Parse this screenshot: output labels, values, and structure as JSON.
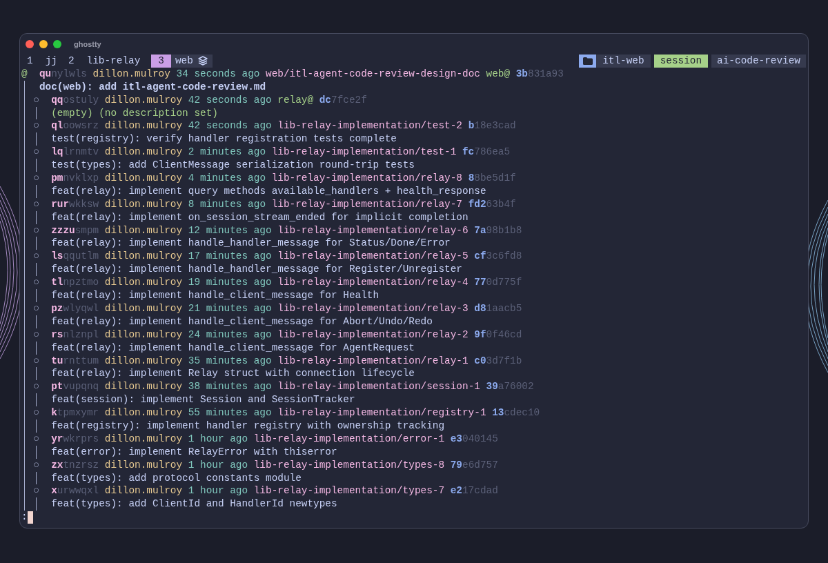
{
  "window": {
    "title": "ghostty"
  },
  "tabs": [
    {
      "index": "1",
      "label": "jj",
      "selected": false
    },
    {
      "index": "2",
      "label": "lib-relay",
      "selected": false
    },
    {
      "index": "3",
      "label": "web",
      "selected": true
    }
  ],
  "session": {
    "directory": "itl-web",
    "name": "session",
    "project": "ai-code-review"
  },
  "log": [
    {
      "kind": "working_copy",
      "marker": "@",
      "change_prefix": "qu",
      "change_rest": "nylwls",
      "author": "dillon.mulroy",
      "time": "34 seconds ago",
      "bookmarks": [
        {
          "name": "web/itl-agent-code-review-design-doc",
          "kind": "local"
        },
        {
          "name": "web@",
          "kind": "remote"
        }
      ],
      "commit_prefix": "3b",
      "commit_rest": "831a93",
      "description": "doc(web): add itl-agent-code-review.md",
      "description_empty": false
    },
    {
      "kind": "commit",
      "marker": "○",
      "change_prefix": "qq",
      "change_rest": "ostuly",
      "author": "dillon.mulroy",
      "time": "42 seconds ago",
      "bookmarks": [
        {
          "name": "relay@",
          "kind": "remote"
        }
      ],
      "commit_prefix": "dc",
      "commit_rest": "7fce2f",
      "description": "(empty) (no description set)",
      "description_empty": true
    },
    {
      "kind": "commit",
      "marker": "○",
      "change_prefix": "ql",
      "change_rest": "oowsrz",
      "author": "dillon.mulroy",
      "time": "42 seconds ago",
      "bookmarks": [
        {
          "name": "lib-relay-implementation/test-2",
          "kind": "local"
        }
      ],
      "commit_prefix": "b",
      "commit_rest": "18e3cad",
      "description": "test(registry): verify handler registration tests complete",
      "description_empty": false
    },
    {
      "kind": "commit",
      "marker": "○",
      "change_prefix": "lq",
      "change_rest": "lrnmtv",
      "author": "dillon.mulroy",
      "time": "2 minutes ago",
      "bookmarks": [
        {
          "name": "lib-relay-implementation/test-1",
          "kind": "local"
        }
      ],
      "commit_prefix": "fc",
      "commit_rest": "786ea5",
      "description": "test(types): add ClientMessage serialization round-trip tests",
      "description_empty": false
    },
    {
      "kind": "commit",
      "marker": "○",
      "change_prefix": "pm",
      "change_rest": "nvklxp",
      "author": "dillon.mulroy",
      "time": "4 minutes ago",
      "bookmarks": [
        {
          "name": "lib-relay-implementation/relay-8",
          "kind": "local"
        }
      ],
      "commit_prefix": "8",
      "commit_rest": "8be5d1f",
      "description": "feat(relay): implement query methods available_handlers + health_response",
      "description_empty": false
    },
    {
      "kind": "commit",
      "marker": "○",
      "change_prefix": "rur",
      "change_rest": "wkksw",
      "author": "dillon.mulroy",
      "time": "8 minutes ago",
      "bookmarks": [
        {
          "name": "lib-relay-implementation/relay-7",
          "kind": "local"
        }
      ],
      "commit_prefix": "fd2",
      "commit_rest": "63b4f",
      "description": "feat(relay): implement on_session_stream_ended for implicit completion",
      "description_empty": false
    },
    {
      "kind": "commit",
      "marker": "○",
      "change_prefix": "zzzu",
      "change_rest": "smpm",
      "author": "dillon.mulroy",
      "time": "12 minutes ago",
      "bookmarks": [
        {
          "name": "lib-relay-implementation/relay-6",
          "kind": "local"
        }
      ],
      "commit_prefix": "7a",
      "commit_rest": "98b1b8",
      "description": "feat(relay): implement handle_handler_message for Status/Done/Error",
      "description_empty": false
    },
    {
      "kind": "commit",
      "marker": "○",
      "change_prefix": "ls",
      "change_rest": "qqutlm",
      "author": "dillon.mulroy",
      "time": "17 minutes ago",
      "bookmarks": [
        {
          "name": "lib-relay-implementation/relay-5",
          "kind": "local"
        }
      ],
      "commit_prefix": "cf",
      "commit_rest": "3c6fd8",
      "description": "feat(relay): implement handle_handler_message for Register/Unregister",
      "description_empty": false
    },
    {
      "kind": "commit",
      "marker": "○",
      "change_prefix": "tl",
      "change_rest": "npztmo",
      "author": "dillon.mulroy",
      "time": "19 minutes ago",
      "bookmarks": [
        {
          "name": "lib-relay-implementation/relay-4",
          "kind": "local"
        }
      ],
      "commit_prefix": "77",
      "commit_rest": "0d775f",
      "description": "feat(relay): implement handle_client_message for Health",
      "description_empty": false
    },
    {
      "kind": "commit",
      "marker": "○",
      "change_prefix": "pz",
      "change_rest": "wlyqwl",
      "author": "dillon.mulroy",
      "time": "21 minutes ago",
      "bookmarks": [
        {
          "name": "lib-relay-implementation/relay-3",
          "kind": "local"
        }
      ],
      "commit_prefix": "d8",
      "commit_rest": "1aacb5",
      "description": "feat(relay): implement handle_client_message for Abort/Undo/Redo",
      "description_empty": false
    },
    {
      "kind": "commit",
      "marker": "○",
      "change_prefix": "rs",
      "change_rest": "nlznpl",
      "author": "dillon.mulroy",
      "time": "24 minutes ago",
      "bookmarks": [
        {
          "name": "lib-relay-implementation/relay-2",
          "kind": "local"
        }
      ],
      "commit_prefix": "9f",
      "commit_rest": "0f46cd",
      "description": "feat(relay): implement handle_client_message for AgentRequest",
      "description_empty": false
    },
    {
      "kind": "commit",
      "marker": "○",
      "change_prefix": "tu",
      "change_rest": "rnttum",
      "author": "dillon.mulroy",
      "time": "35 minutes ago",
      "bookmarks": [
        {
          "name": "lib-relay-implementation/relay-1",
          "kind": "local"
        }
      ],
      "commit_prefix": "c0",
      "commit_rest": "3d7f1b",
      "description": "feat(relay): implement Relay struct with connection lifecycle",
      "description_empty": false
    },
    {
      "kind": "commit",
      "marker": "○",
      "change_prefix": "pt",
      "change_rest": "vupqnq",
      "author": "dillon.mulroy",
      "time": "38 minutes ago",
      "bookmarks": [
        {
          "name": "lib-relay-implementation/session-1",
          "kind": "local"
        }
      ],
      "commit_prefix": "39",
      "commit_rest": "a76002",
      "description": "feat(session): implement Session and SessionTracker",
      "description_empty": false
    },
    {
      "kind": "commit",
      "marker": "○",
      "change_prefix": "k",
      "change_rest": "tpmxymr",
      "author": "dillon.mulroy",
      "time": "55 minutes ago",
      "bookmarks": [
        {
          "name": "lib-relay-implementation/registry-1",
          "kind": "local"
        }
      ],
      "commit_prefix": "13",
      "commit_rest": "cdec10",
      "description": "feat(registry): implement handler registry with ownership tracking",
      "description_empty": false
    },
    {
      "kind": "commit",
      "marker": "○",
      "change_prefix": "yr",
      "change_rest": "wkrprs",
      "author": "dillon.mulroy",
      "time": "1 hour ago",
      "bookmarks": [
        {
          "name": "lib-relay-implementation/error-1",
          "kind": "local"
        }
      ],
      "commit_prefix": "e3",
      "commit_rest": "040145",
      "description": "feat(error): implement RelayError with thiserror",
      "description_empty": false
    },
    {
      "kind": "commit",
      "marker": "○",
      "change_prefix": "zx",
      "change_rest": "tnzrsz",
      "author": "dillon.mulroy",
      "time": "1 hour ago",
      "bookmarks": [
        {
          "name": "lib-relay-implementation/types-8",
          "kind": "local"
        }
      ],
      "commit_prefix": "79",
      "commit_rest": "e6d757",
      "description": "feat(types): add protocol constants module",
      "description_empty": false
    },
    {
      "kind": "commit",
      "marker": "○",
      "change_prefix": "x",
      "change_rest": "urwwqxl",
      "author": "dillon.mulroy",
      "time": "1 hour ago",
      "bookmarks": [
        {
          "name": "lib-relay-implementation/types-7",
          "kind": "local"
        }
      ],
      "commit_prefix": "e2",
      "commit_rest": "17cdad",
      "description": "feat(types): add ClientId and HandlerId newtypes",
      "description_empty": false
    }
  ],
  "prompt": ":"
}
